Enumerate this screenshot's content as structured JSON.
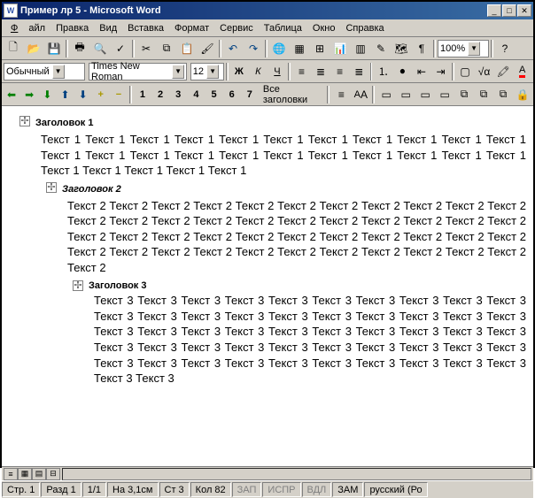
{
  "window": {
    "title": "Пример лр 5 - Microsoft Word"
  },
  "menu": {
    "file": "Файл",
    "edit": "Правка",
    "view": "Вид",
    "insert": "Вставка",
    "format": "Формат",
    "tools": "Сервис",
    "table": "Таблица",
    "window": "Окно",
    "help": "Справка"
  },
  "toolbar": {
    "zoom": "100%"
  },
  "format": {
    "style": "Обычный",
    "font": "Times New Roman",
    "size": "12"
  },
  "outline": {
    "levels": [
      "1",
      "2",
      "3",
      "4",
      "5",
      "6",
      "7"
    ],
    "all": "Все заголовки"
  },
  "doc": {
    "h1": "Заголовок 1",
    "t1": "Текст 1 Текст 1 Текст 1 Текст 1 Текст 1 Текст 1 Текст 1 Текст 1 Текст 1 Текст 1 Текст 1 Текст 1 Текст 1 Текст 1 Текст 1 Текст 1 Текст 1 Текст 1 Текст 1 Текст 1 Текст 1 Текст 1 Текст 1 Текст 1 Текст 1 Текст 1 Текст 1",
    "h2": "Заголовок 2",
    "t2": "Текст 2 Текст 2 Текст 2 Текст 2 Текст 2 Текст 2 Текст 2 Текст 2 Текст 2 Текст 2 Текст 2 Текст 2 Текст 2 Текст 2 Текст 2 Текст 2 Текст 2 Текст 2 Текст 2 Текст 2 Текст 2 Текст 2 Текст 2 Текст 2 Текст 2 Текст 2 Текст 2 Текст 2 Текст 2 Текст 2 Текст 2 Текст 2 Текст 2 Текст 2 Текст 2 Текст 2 Текст 2 Текст 2 Текст 2 Текст 2 Текст 2 Текст 2 Текст 2 Текст 2 Текст 2",
    "h3": "Заголовок 3",
    "t3": "Текст 3 Текст 3 Текст 3 Текст 3 Текст 3 Текст 3 Текст 3 Текст 3 Текст 3 Текст 3 Текст 3 Текст 3 Текст 3 Текст 3 Текст 3 Текст 3 Текст 3 Текст 3 Текст 3 Текст 3 Текст 3 Текст 3 Текст 3 Текст 3 Текст 3 Текст 3 Текст 3 Текст 3 Текст 3 Текст 3 Текст 3 Текст 3 Текст 3 Текст 3 Текст 3 Текст 3 Текст 3 Текст 3 Текст 3 Текст 3 Текст 3 Текст 3 Текст 3 Текст 3 Текст 3 Текст 3 Текст 3 Текст 3 Текст 3 Текст 3 Текст 3 Текст 3"
  },
  "status": {
    "page": "Стр. 1",
    "section": "Разд 1",
    "pages": "1/1",
    "pos": "На 3,1см",
    "line": "Ст 3",
    "col": "Кол 82",
    "rec": "ЗАП",
    "trk": "ИСПР",
    "ext": "ВДЛ",
    "ovr": "ЗАМ",
    "lang": "русский (Ро"
  }
}
